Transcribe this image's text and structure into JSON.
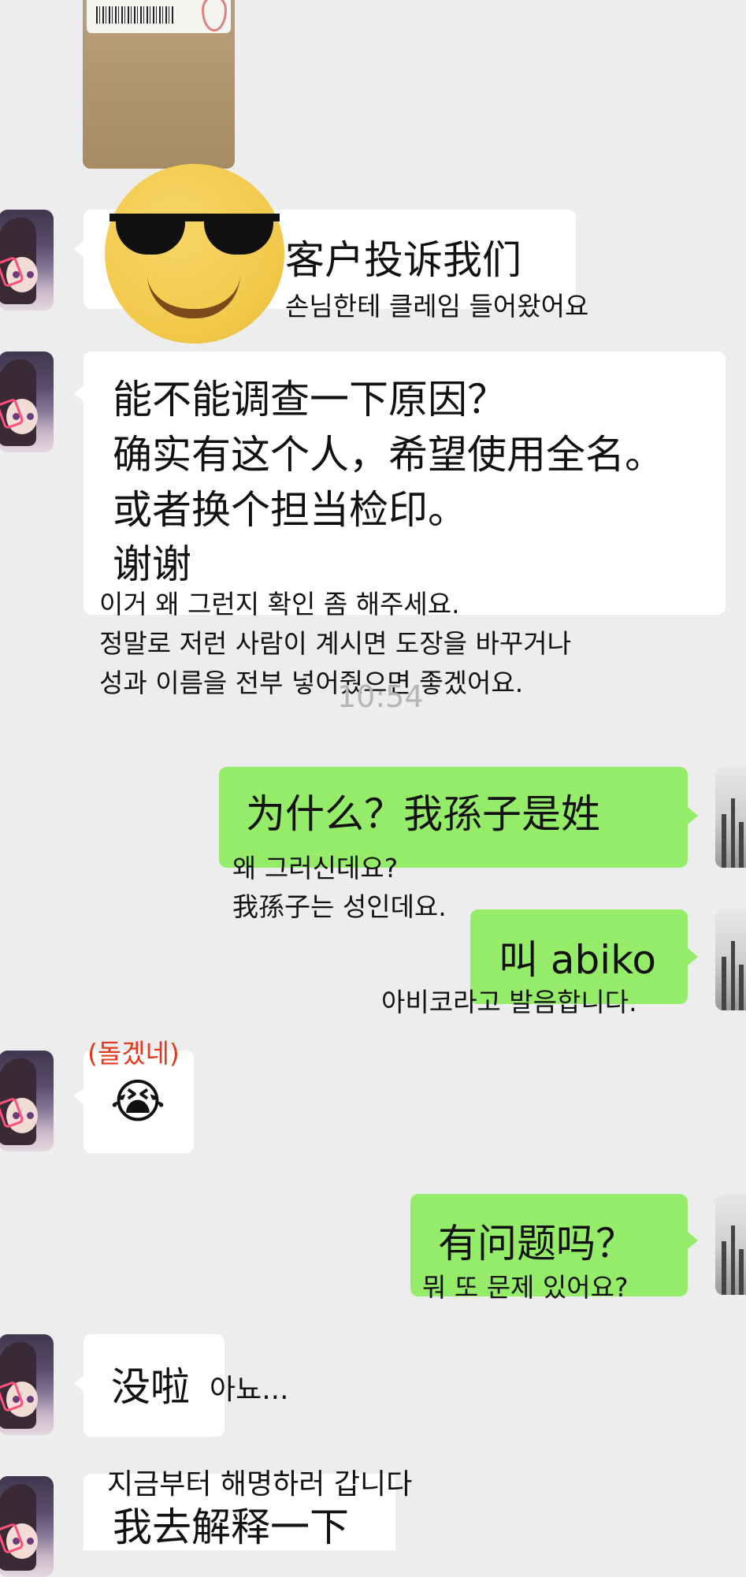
{
  "time_stamp": "10:54",
  "msgs": {
    "m1": {
      "cn": "客户投诉我们",
      "kr": "손님한테 클레임 들어왔어요"
    },
    "m2": {
      "cn": [
        "能不能调查一下原因？",
        "确实有这个人，希望使用全名。",
        "或者换个担当检印。",
        "谢谢"
      ],
      "kr": [
        "이거 왜 그런지 확인 좀 해주세요.",
        "정말로 저런 사람이 계시면 도장을 바꾸거나",
        "성과 이름을 전부 넣어줬으면 좋겠어요."
      ]
    },
    "m3": {
      "cn": "为什么？我孫子是姓",
      "kr": [
        "왜 그러신데요?",
        "我孫子는 성인데요."
      ]
    },
    "m4": {
      "cn": "叫 abiko",
      "kr": "아비코라고 발음합니다."
    },
    "m5": {
      "caption": "(돌겠네)",
      "emoji": "😭"
    },
    "m6": {
      "cn": "有问题吗？",
      "kr": "뭐 또 문제 있어요?"
    },
    "m7": {
      "cn": "没啦",
      "kr": "아뇨..."
    },
    "m8": {
      "kr": "지금부터 해명하러 갑니다",
      "cn": "我去解释一下"
    }
  }
}
